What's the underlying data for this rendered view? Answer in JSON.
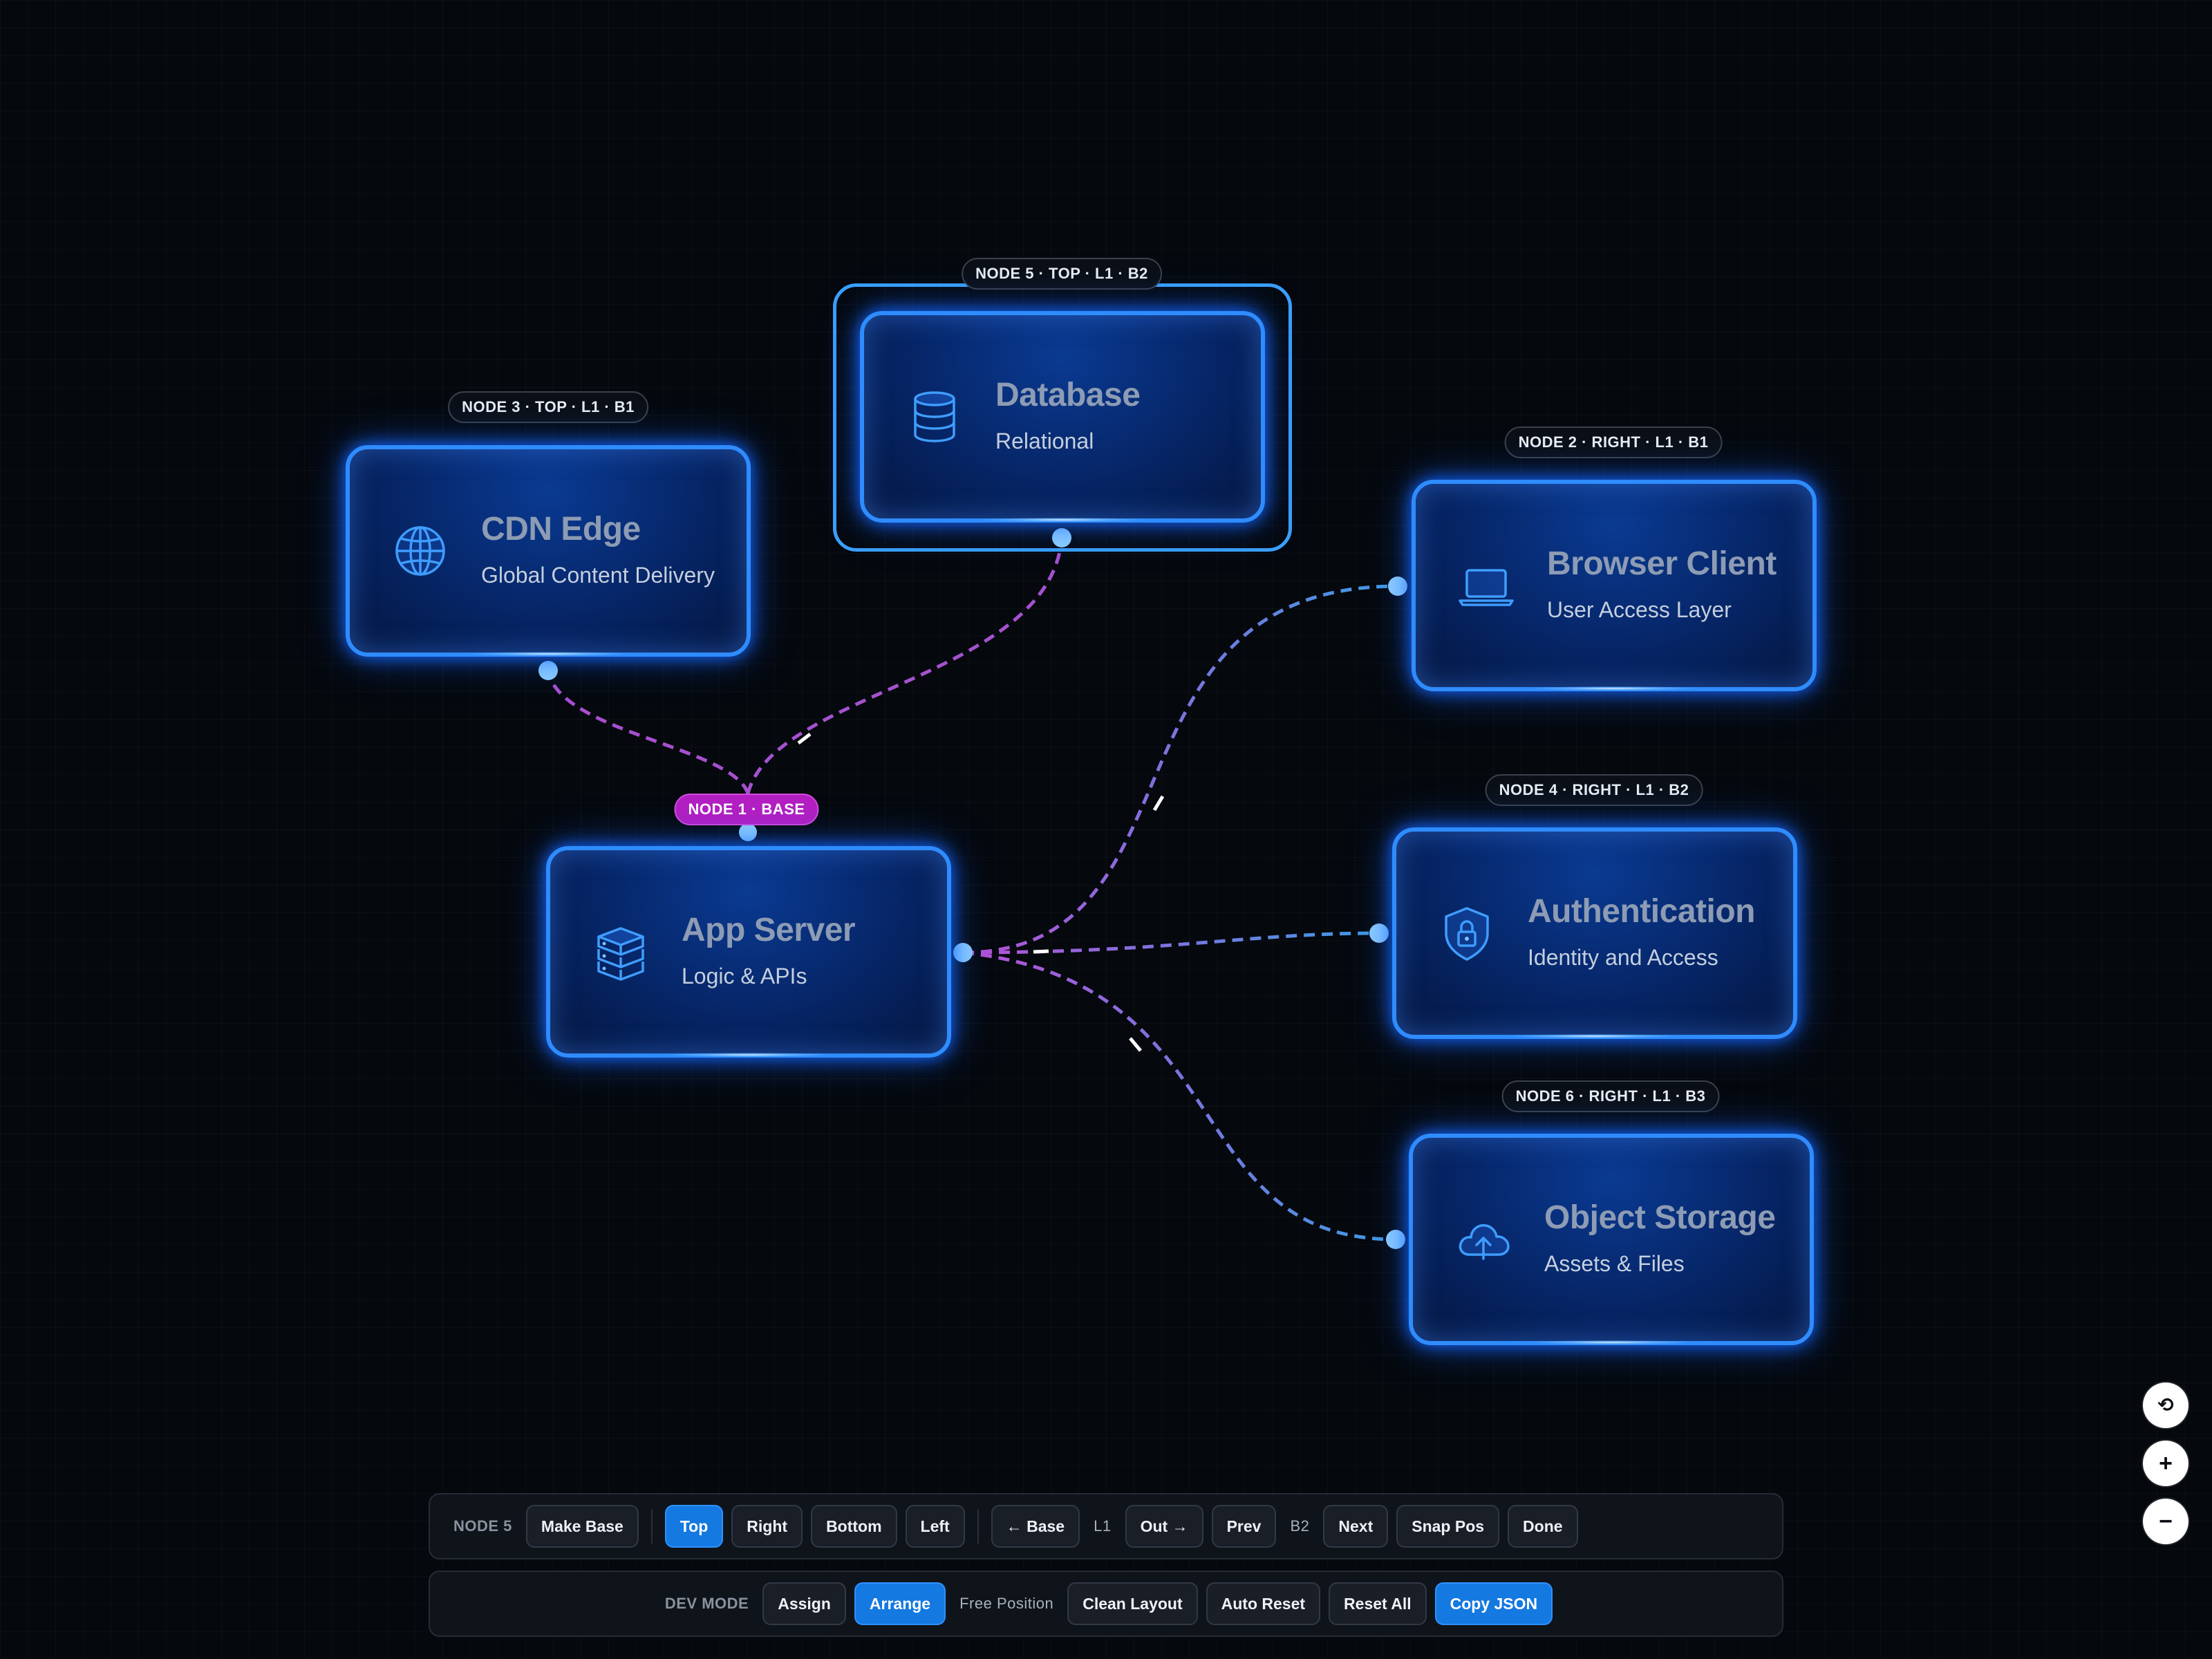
{
  "nodes": [
    {
      "id": "n1",
      "title": "App Server",
      "subtitle": "Logic & APIs",
      "label": "NODE 1 · BASE",
      "icon": "server-icon"
    },
    {
      "id": "n2",
      "title": "Browser Client",
      "subtitle": "User Access Layer",
      "label": "NODE 2 · RIGHT · L1 · B1",
      "icon": "laptop-icon"
    },
    {
      "id": "n3",
      "title": "CDN Edge",
      "subtitle": "Global Content Delivery",
      "label": "NODE 3 · TOP · L1 · B1",
      "icon": "globe-icon"
    },
    {
      "id": "n4",
      "title": "Authentication",
      "subtitle": "Identity and Access",
      "label": "NODE 4 · RIGHT · L1 · B2",
      "icon": "shield-lock-icon"
    },
    {
      "id": "n5",
      "title": "Database",
      "subtitle": "Relational",
      "label": "NODE 5 · TOP · L1 · B2",
      "icon": "database-icon"
    },
    {
      "id": "n6",
      "title": "Object Storage",
      "subtitle": "Assets & Files",
      "label": "NODE 6 · RIGHT · L1 · B3",
      "icon": "cloud-upload-icon"
    }
  ],
  "edges": [
    {
      "from": "n1",
      "to": "n3"
    },
    {
      "from": "n1",
      "to": "n5"
    },
    {
      "from": "n1",
      "to": "n2"
    },
    {
      "from": "n1",
      "to": "n4"
    },
    {
      "from": "n1",
      "to": "n6"
    }
  ],
  "colors": {
    "edge_start": "#b84fd6",
    "edge_end": "#3d9be6",
    "port": "#8fcfff",
    "base_badge": "#b31fc1",
    "accent": "#1479e0"
  },
  "toolbar1": {
    "node_label": "NODE 5",
    "make_base": "Make Base",
    "top": "Top",
    "right": "Right",
    "bottom": "Bottom",
    "left": "Left",
    "to_base": "← Base",
    "level": "L1",
    "out": "Out →",
    "prev": "Prev",
    "branch": "B2",
    "next": "Next",
    "snap_pos": "Snap Pos",
    "done": "Done"
  },
  "toolbar2": {
    "dev_mode": "DEV MODE",
    "assign": "Assign",
    "arrange": "Arrange",
    "free_position": "Free Position",
    "clean_layout": "Clean Layout",
    "auto_reset": "Auto Reset",
    "reset_all": "Reset All",
    "copy_json": "Copy JSON"
  },
  "zoom": {
    "reset": "⟲",
    "zoom_in": "+",
    "zoom_out": "−"
  }
}
